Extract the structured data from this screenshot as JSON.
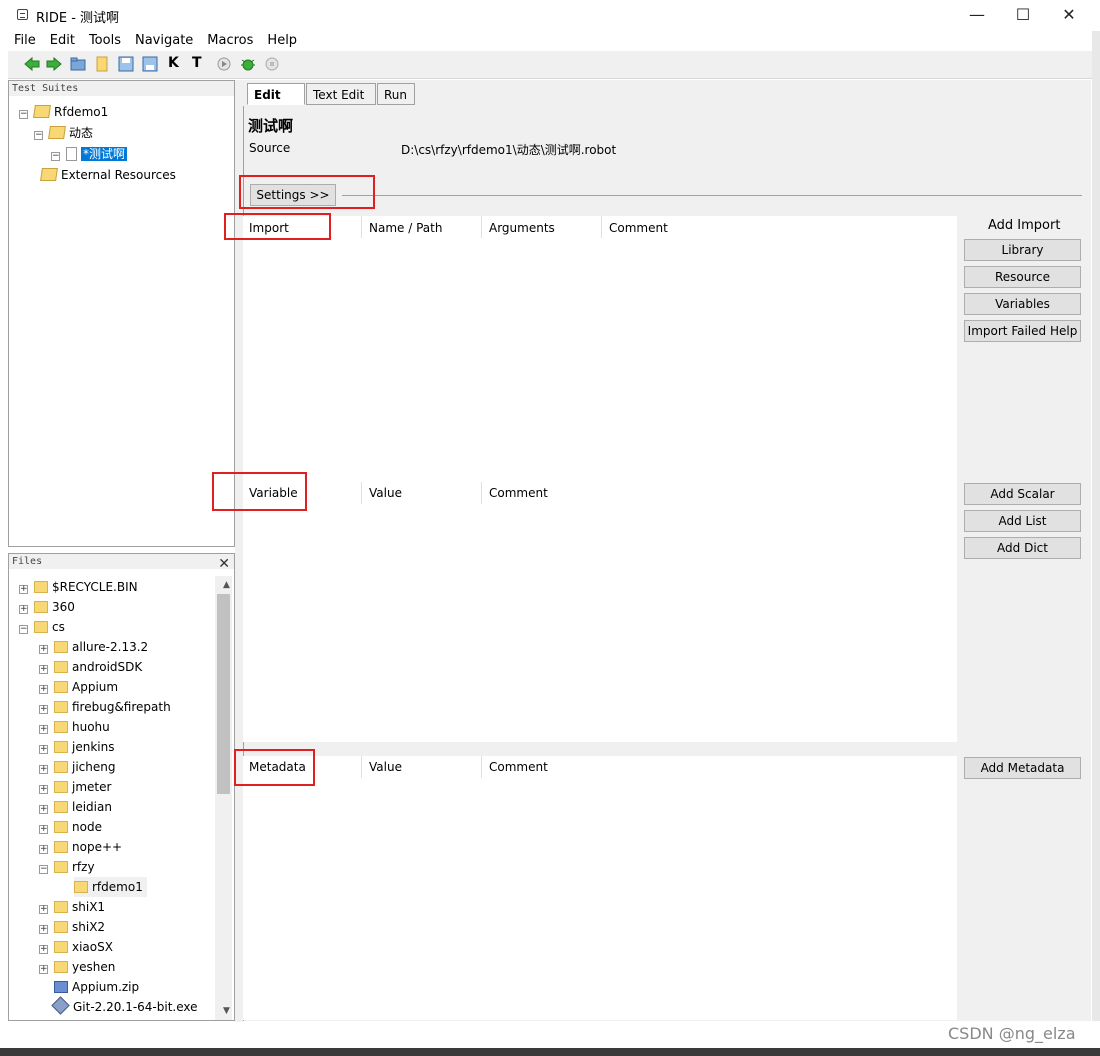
{
  "window": {
    "title": "RIDE - 测试啊",
    "minimize_glyph": "—",
    "maximize_glyph": "☐",
    "close_glyph": "✕"
  },
  "menu": [
    "File",
    "Edit",
    "Tools",
    "Navigate",
    "Macros",
    "Help"
  ],
  "toolbar": {
    "icons": [
      "back-arrow-icon",
      "forward-arrow-icon",
      "open-folder-icon",
      "new-folder-icon",
      "save-icon",
      "save-all-icon",
      "search-keyword-icon",
      "search-tests-icon",
      "run-icon",
      "bug-icon",
      "stop-icon"
    ],
    "k_label": "K",
    "t_label": "T"
  },
  "suites_pane": {
    "header": "Test Suites",
    "items": [
      {
        "label": "Rfdemo1"
      },
      {
        "label": "动态"
      },
      {
        "label": "*测试啊"
      },
      {
        "label": "External Resources"
      }
    ]
  },
  "files_pane": {
    "header": "Files",
    "close_glyph": "✕",
    "items": [
      {
        "label": "$RECYCLE.BIN"
      },
      {
        "label": "360"
      },
      {
        "label": "cs"
      },
      {
        "label": "allure-2.13.2"
      },
      {
        "label": "androidSDK"
      },
      {
        "label": "Appium"
      },
      {
        "label": "firebug&firepath"
      },
      {
        "label": "huohu"
      },
      {
        "label": "jenkins"
      },
      {
        "label": "jicheng"
      },
      {
        "label": "jmeter"
      },
      {
        "label": "leidian"
      },
      {
        "label": "node"
      },
      {
        "label": "nope++"
      },
      {
        "label": "rfzy"
      },
      {
        "label": "rfdemo1"
      },
      {
        "label": "shiX1"
      },
      {
        "label": "shiX2"
      },
      {
        "label": "xiaoSX"
      },
      {
        "label": "yeshen"
      },
      {
        "label": "Appium.zip"
      },
      {
        "label": "Git-2.20.1-64-bit.exe"
      }
    ]
  },
  "tabs": [
    {
      "label": "Edit",
      "close": "✕"
    },
    {
      "label": "Text Edit"
    },
    {
      "label": "Run"
    }
  ],
  "editor": {
    "suite_name": "测试啊",
    "source_label": "Source",
    "source_path": "D:\\cs\\rfzy\\rfdemo1\\动态\\测试啊.robot",
    "settings_button": "Settings >>",
    "import_table": {
      "headers": [
        "Import",
        "Name / Path",
        "Arguments",
        "Comment"
      ],
      "title": "Add Import",
      "buttons": [
        "Library",
        "Resource",
        "Variables",
        "Import Failed Help"
      ]
    },
    "variable_table": {
      "headers": [
        "Variable",
        "Value",
        "Comment"
      ],
      "buttons": [
        "Add Scalar",
        "Add List",
        "Add Dict"
      ]
    },
    "metadata_table": {
      "headers": [
        "Metadata",
        "Value",
        "Comment"
      ],
      "buttons": [
        "Add Metadata"
      ]
    }
  },
  "watermark": "CSDN @ng_elza",
  "highlight_color": "#e02020",
  "selection_color": "#0078d7"
}
